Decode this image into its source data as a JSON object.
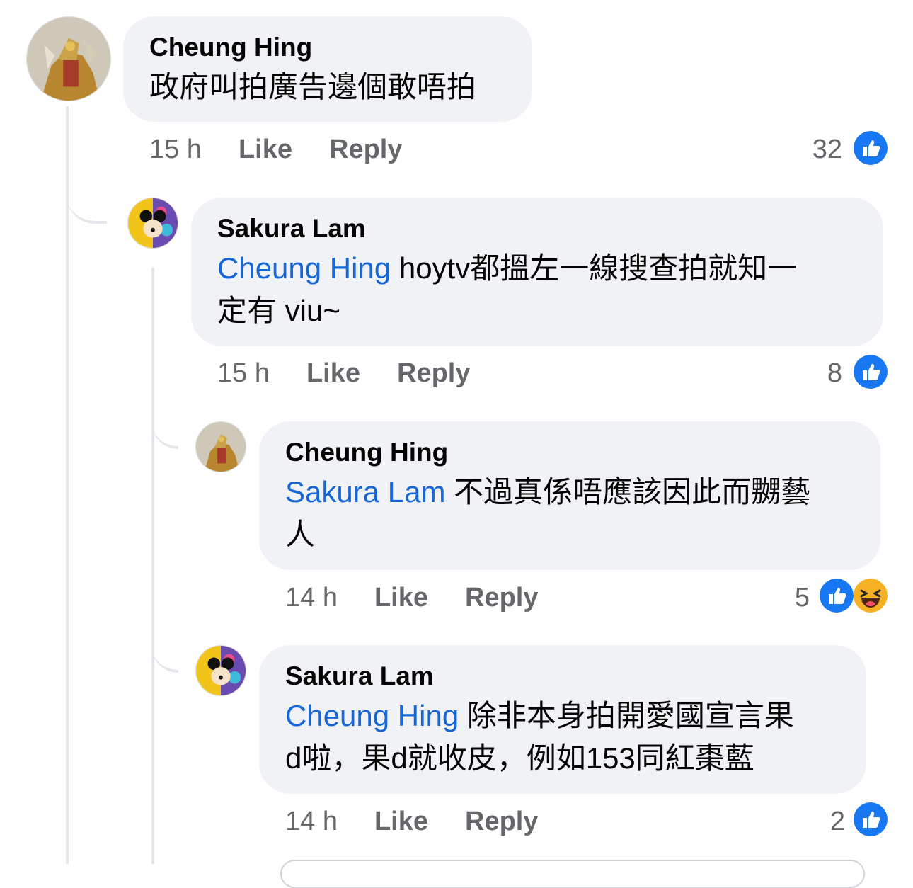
{
  "comments": [
    {
      "author": "Cheung Hing",
      "text": "政府叫拍廣告邊個敢唔拍",
      "time": "15 h",
      "like": "Like",
      "reply": "Reply",
      "reaction_count": "32"
    },
    {
      "author": "Sakura Lam",
      "mention": "Cheung Hing",
      "text_line1": " hoytv都搵左一線搜查拍就知一",
      "text_line2": "定有 viu~",
      "time": "15 h",
      "like": "Like",
      "reply": "Reply",
      "reaction_count": "8"
    },
    {
      "author": "Cheung Hing",
      "mention": "Sakura Lam",
      "text_line1": " 不過真係唔應該因此而嬲藝",
      "text_line2": "人",
      "time": "14 h",
      "like": "Like",
      "reply": "Reply",
      "reaction_count": "5"
    },
    {
      "author": "Sakura Lam",
      "mention": "Cheung Hing",
      "text_line1": " 除非本身拍開愛國宣言果",
      "text_line2": "d啦，果d就收皮，例如153同紅棗藍",
      "time": "14 h",
      "like": "Like",
      "reply": "Reply",
      "reaction_count": "2"
    }
  ],
  "colors": {
    "like_blue": "#1877f2",
    "mention_blue": "#1666d6",
    "bubble_bg": "#f0f2f5",
    "meta_gray": "#65676b"
  },
  "icons": {
    "like": "thumbs-up-icon",
    "haha": "laughing-face-icon"
  }
}
